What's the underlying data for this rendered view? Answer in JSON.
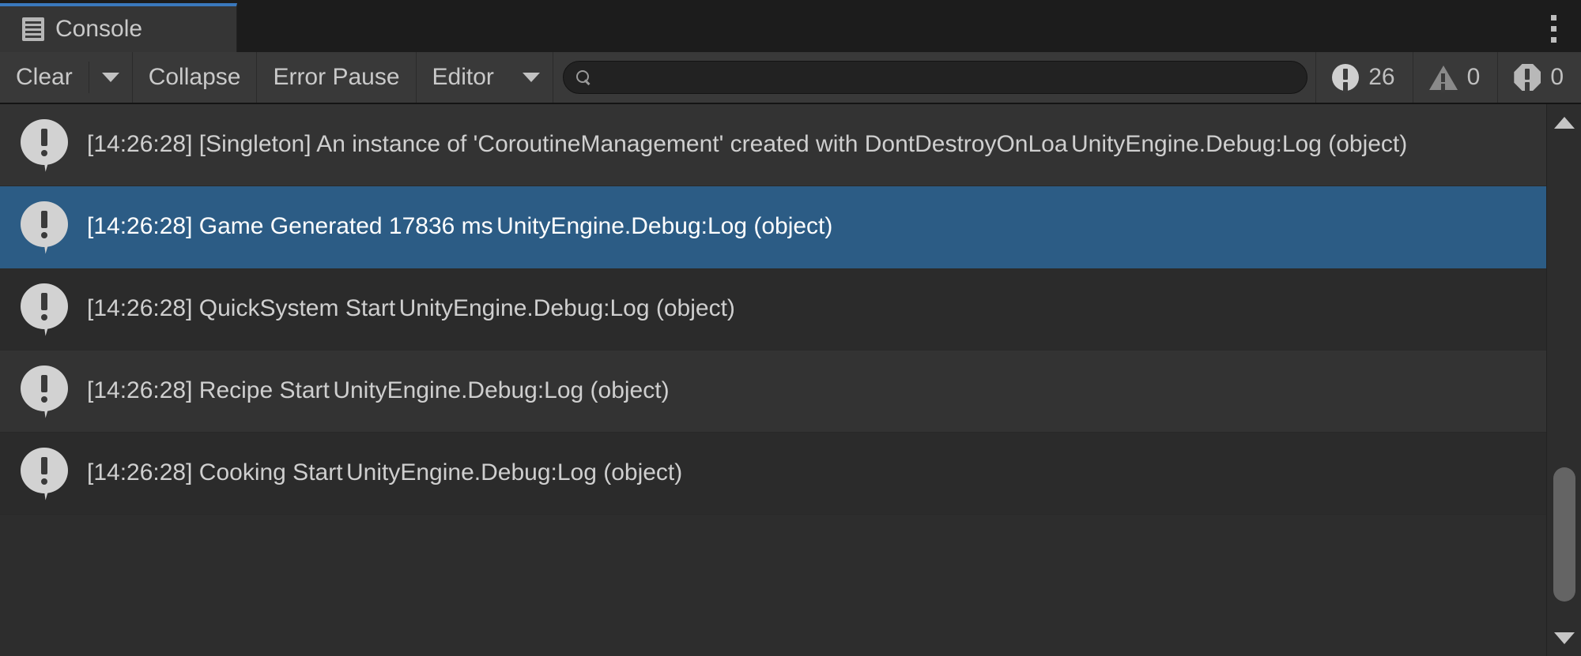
{
  "window": {
    "tab_label": "Console",
    "tab_icon": "console-page-icon",
    "menu_icon": "kebab-menu-icon",
    "accent_color": "#3a79bd",
    "selection_color": "#2c5c85"
  },
  "toolbar": {
    "clear_label": "Clear",
    "clear_dropdown_icon": "chevron-down-icon",
    "collapse_label": "Collapse",
    "error_pause_label": "Error Pause",
    "editor_label": "Editor",
    "editor_dropdown_icon": "chevron-down-icon",
    "search_icon": "search-icon",
    "search_value": "",
    "search_placeholder": "",
    "counters": {
      "log_icon": "log-info-icon",
      "log_count": "26",
      "warning_icon": "warning-triangle-icon",
      "warning_count": "0",
      "error_icon": "error-octagon-icon",
      "error_count": "0"
    }
  },
  "log": {
    "entries": [
      {
        "icon": "log-info-bubble-icon",
        "message": "[14:26:28] [Singleton] An instance of 'CoroutineManagement' created with DontDestroyOnLoa",
        "stack": "UnityEngine.Debug:Log (object)",
        "selected": false
      },
      {
        "icon": "log-info-bubble-icon",
        "message": "[14:26:28] Game Generated 17836 ms",
        "stack": "UnityEngine.Debug:Log (object)",
        "selected": true
      },
      {
        "icon": "log-info-bubble-icon",
        "message": "[14:26:28] QuickSystem Start",
        "stack": "UnityEngine.Debug:Log (object)",
        "selected": false
      },
      {
        "icon": "log-info-bubble-icon",
        "message": "[14:26:28] Recipe Start",
        "stack": "UnityEngine.Debug:Log (object)",
        "selected": false
      },
      {
        "icon": "log-info-bubble-icon",
        "message": "[14:26:28] Cooking Start",
        "stack": "UnityEngine.Debug:Log (object)",
        "selected": false
      }
    ]
  },
  "scrollbar": {
    "up_arrow_icon": "scroll-up-arrow-icon",
    "down_arrow_icon": "scroll-down-arrow-icon",
    "thumb": "scrollbar-thumb"
  }
}
